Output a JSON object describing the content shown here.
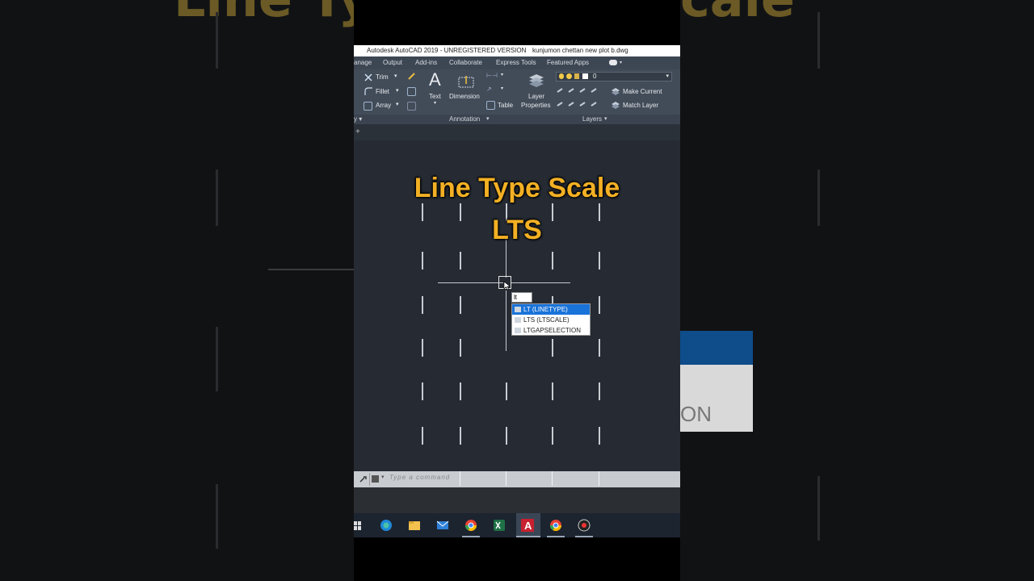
{
  "window": {
    "title": "Autodesk AutoCAD 2019 - UNREGISTERED VERSION",
    "file": "kunjumon chettan new plot b.dwg"
  },
  "menu": {
    "items": [
      "anage",
      "Output",
      "Add-ins",
      "Collaborate",
      "Express Tools",
      "Featured Apps"
    ]
  },
  "ribbon": {
    "modify": {
      "trim": "Trim",
      "fillet": "Fillet",
      "array": "Array"
    },
    "annotation": {
      "text": "Text",
      "dimension": "Dimension",
      "table": "Table",
      "panel_label": "Annotation"
    },
    "layers": {
      "layer_properties_line1": "Layer",
      "layer_properties_line2": "Properties",
      "current_layer": "0",
      "make_current": "Make Current",
      "match_layer": "Match Layer",
      "panel_label": "Layers"
    }
  },
  "overlay": {
    "line1": "Line Type Scale",
    "line2": "LTS"
  },
  "command": {
    "typed": "lt",
    "placeholder": "Type a command",
    "suggestions": [
      "LT (LINETYPE)",
      "LTS (LTSCALE)",
      "LTGAPSELECTION"
    ]
  },
  "icons": {
    "taskbar": [
      "edge-icon",
      "file-explorer-icon",
      "mail-icon",
      "chrome-icon",
      "excel-icon",
      "autocad-icon",
      "chrome-profile-icon",
      "screen-recorder-icon"
    ]
  },
  "colors": {
    "overlay_text": "#f3b024",
    "canvas": "#252a33",
    "selection": "#1a73d9"
  }
}
